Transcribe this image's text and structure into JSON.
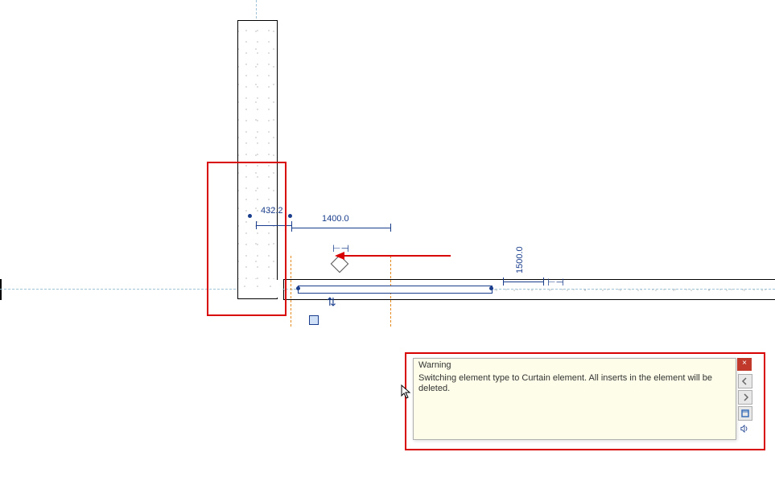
{
  "dimensions": {
    "temp1_value": "432.2",
    "temp2_value": "1400.0",
    "temp3_value": "1500.0"
  },
  "warning": {
    "title": "Warning",
    "message": "Switching element type to Curtain element. All inserts in the element will be deleted.",
    "close_label": "×"
  },
  "icons": {
    "nav_prev": "prev-warning-icon",
    "nav_next": "next-warning-icon",
    "expand": "expand-warning-icon",
    "info": "warning-info-icon"
  },
  "colors": {
    "highlight": "#d90000",
    "dim": "#1a3e8c",
    "extension": "#e58a1f",
    "warning_bg": "#fefde9"
  }
}
